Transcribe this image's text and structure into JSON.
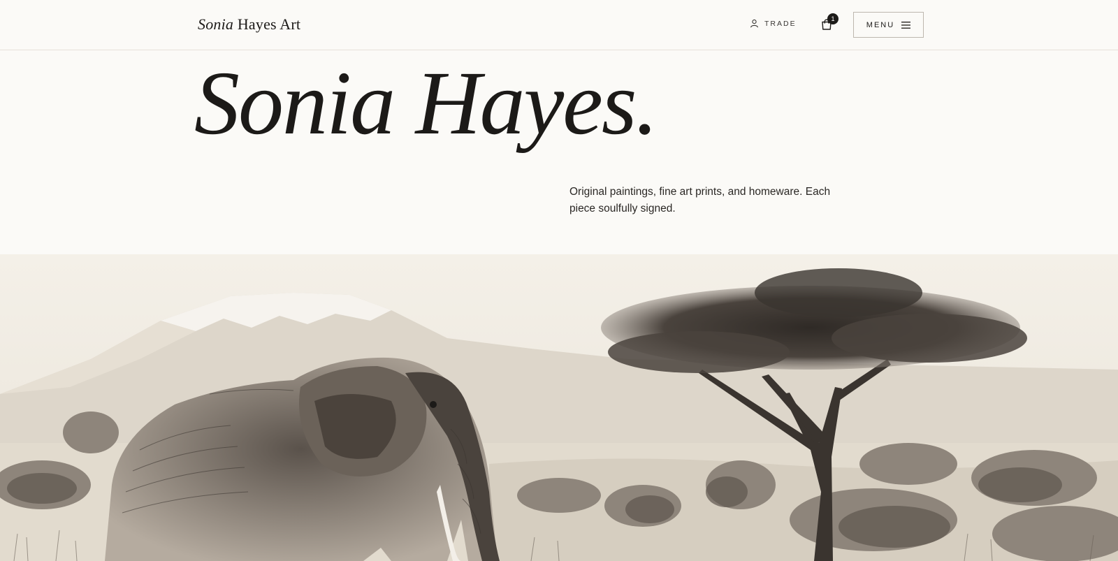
{
  "header": {
    "logo_italic": "Sonia",
    "logo_rest": "Hayes Art",
    "trade_label": "TRADE",
    "cart_count": "1",
    "menu_label": "MENU"
  },
  "hero": {
    "title": "Sonia Hayes.",
    "subtitle": "Original paintings, fine art prints, and homeware. Each piece soulfully signed."
  },
  "artwork": {
    "subject": "elephant-and-acacia-tree-sketch"
  },
  "colors": {
    "background": "#fbfaf7",
    "ink": "#1c1a18",
    "border": "#bdb7ae"
  }
}
